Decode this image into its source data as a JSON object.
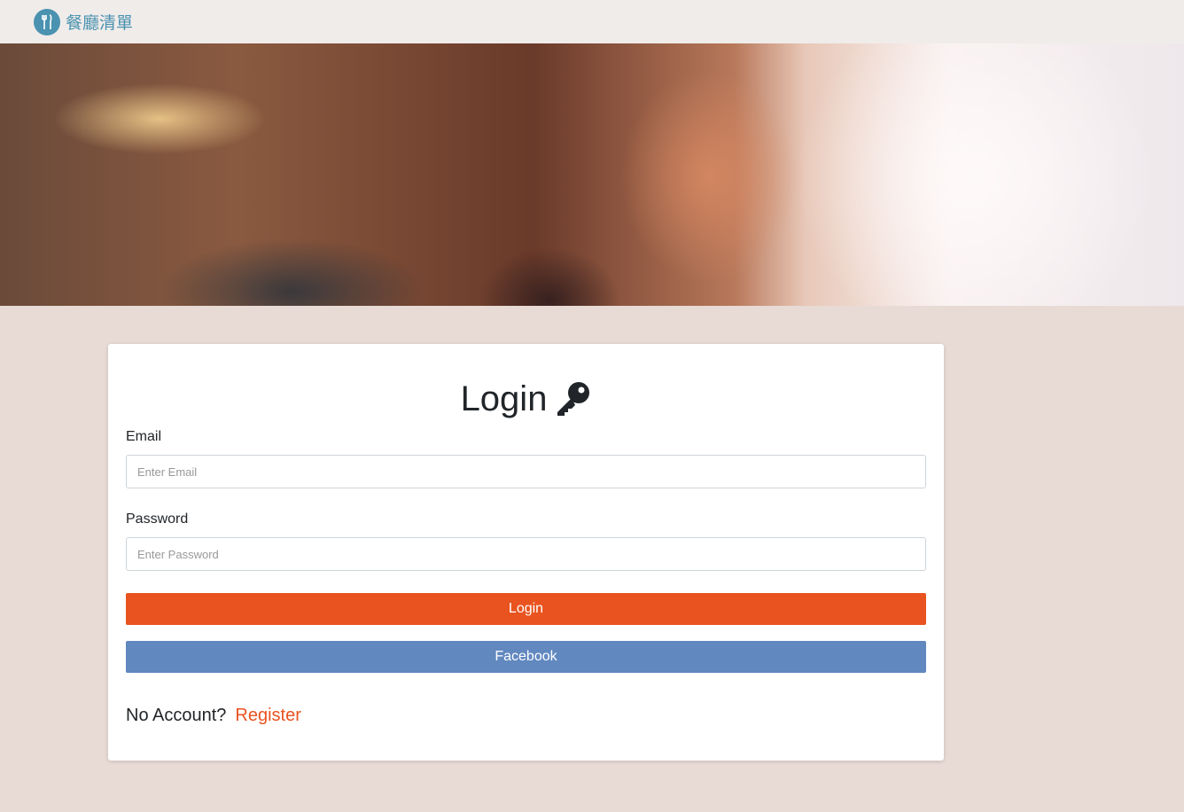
{
  "nav": {
    "brand": "餐廳清單",
    "logo_icon": "utensils-icon"
  },
  "login": {
    "title": "Login",
    "title_icon": "key-icon",
    "email_label": "Email",
    "email_placeholder": "Enter Email",
    "email_value": "",
    "password_label": "Password",
    "password_placeholder": "Enter Password",
    "password_value": "",
    "login_button": "Login",
    "facebook_button": "Facebook",
    "no_account": "No Account?",
    "register_link": "Register"
  },
  "colors": {
    "brand": "#4a92b0",
    "login": "#e9531f",
    "facebook": "#6188bf",
    "background": "#e8dad4"
  }
}
